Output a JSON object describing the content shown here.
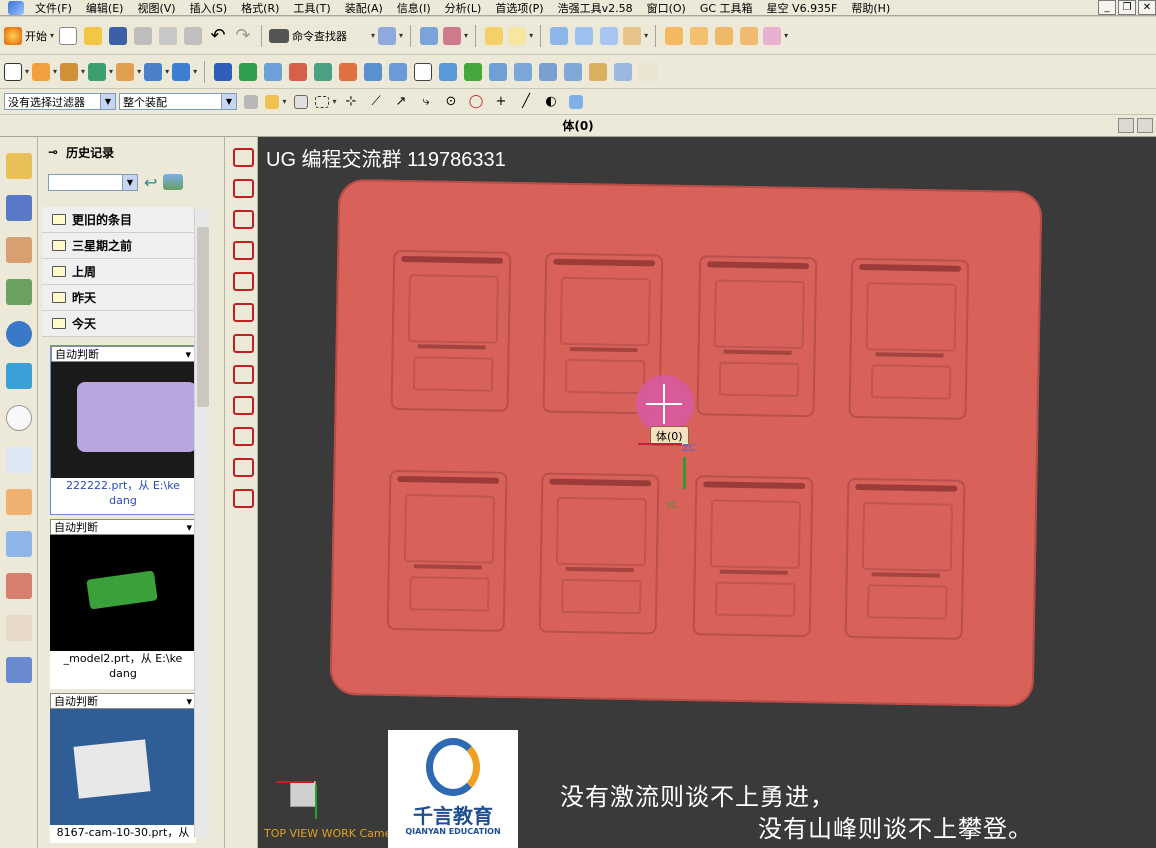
{
  "menu": [
    "文件(F)",
    "编辑(E)",
    "视图(V)",
    "插入(S)",
    "格式(R)",
    "工具(T)",
    "装配(A)",
    "信息(I)",
    "分析(L)",
    "首选项(P)",
    "浩强工具v2.58",
    "窗口(O)",
    "GC 工具箱",
    "星空 V6.935F",
    "帮助(H)"
  ],
  "toolbar": {
    "start_label": "开始",
    "command_finder_label": "命令查找器",
    "filter_value": "没有选择过滤器",
    "scope_value": "整个装配"
  },
  "status_text": "体(0)",
  "resource_panel": {
    "title": "历史记录",
    "groups": [
      "更旧的条目",
      "三星期之前",
      "上周",
      "昨天",
      "今天"
    ],
    "items": [
      {
        "mode": "自动判断",
        "name": "222222.prt，从 E:\\ke dang"
      },
      {
        "mode": "自动判断",
        "name": "_model2.prt，从 E:\\ke dang"
      },
      {
        "mode": "自动判断",
        "name": "8167-cam-10-30.prt，从"
      }
    ]
  },
  "viewport": {
    "title": "UG 编程交流群 119786331",
    "tooltip": "体(0)",
    "axis_z": "ZC",
    "axis_y": "YC",
    "view_label": "TOP VIEW WORK Camera",
    "logo_name": "千言教育",
    "logo_sub": "QIANYAN EDUCATION",
    "quote_line1": "没有激流则谈不上勇进，",
    "quote_line2": "没有山峰则谈不上攀登。"
  },
  "colors": {
    "part": "#d8615a",
    "viewport_bg": "#3a3a3a",
    "ui_bg": "#ece9d8"
  }
}
